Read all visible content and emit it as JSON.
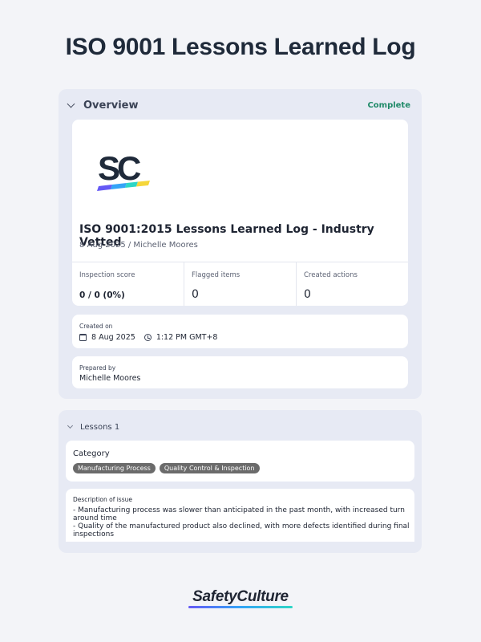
{
  "page": {
    "title": "ISO 9001 Lessons Learned Log"
  },
  "overview": {
    "section_title": "Overview",
    "status": "Complete",
    "report_title": "ISO 9001:2015 Lessons Learned Log - Industry Vetted",
    "report_subtitle": "8 Aug 2025 / Michelle Moores",
    "stats": [
      {
        "label": "Inspection score",
        "value": "0 / 0 (0%)"
      },
      {
        "label": "Flagged items",
        "value": "0"
      },
      {
        "label": "Created actions",
        "value": "0"
      }
    ],
    "created_on": {
      "label": "Created on",
      "date": "8 Aug 2025",
      "time": "1:12 PM GMT+8"
    },
    "prepared_by": {
      "label": "Prepared by",
      "value": "Michelle Moores"
    }
  },
  "lessons": {
    "section_title": "Lessons 1",
    "category": {
      "label": "Category",
      "tags": [
        "Manufacturing Process",
        "Quality Control & Inspection"
      ]
    },
    "description": {
      "label": "Description of issue",
      "text": "- Manufacturing process was slower than anticipated in the past month, with increased turn around time\n- Quality of the manufactured product also declined, with more defects identified during final inspections"
    }
  },
  "footer": {
    "brand": "SafetyCulture"
  },
  "colors": {
    "accent_status": "#1f8a68",
    "logo_text": "#1f2a3a",
    "tag_background": "#6b6b6b",
    "brand_gradient": [
      "#6559f5",
      "#34a4f7",
      "#2ed6c5",
      "#f5d63a"
    ]
  },
  "icons": [
    "chevron-down-icon",
    "calendar-icon",
    "clock-icon",
    "safetyculture-logo"
  ]
}
